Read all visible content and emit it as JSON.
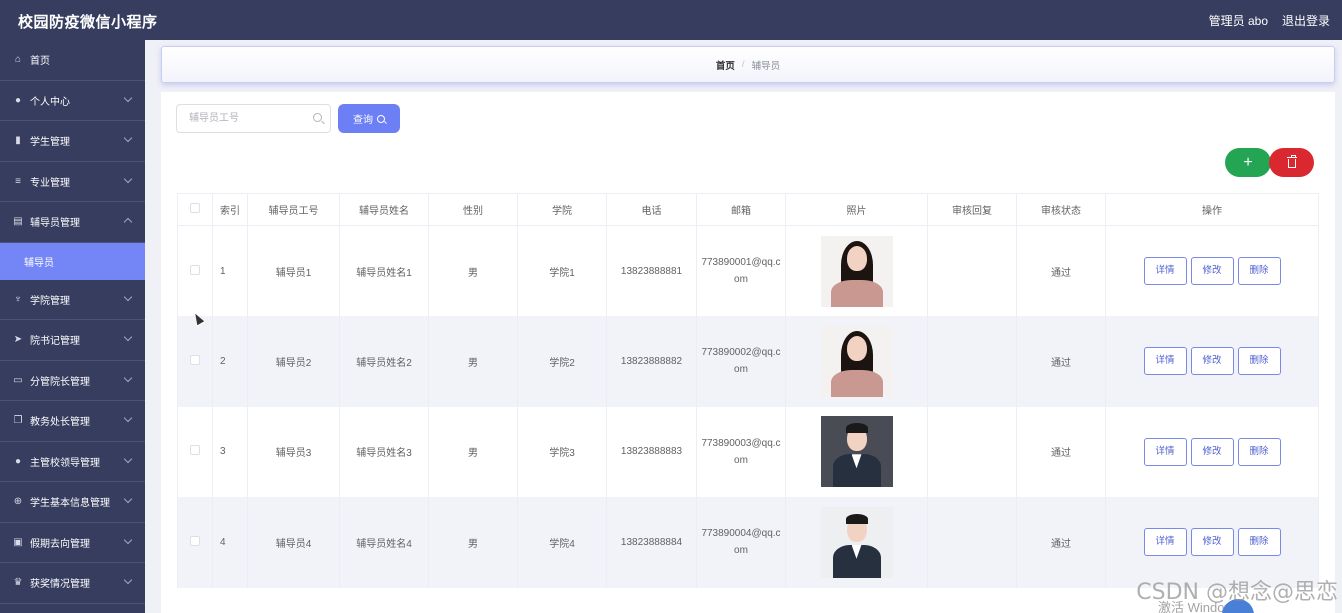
{
  "header": {
    "app_title": "校园防疫微信小程序",
    "user": "管理员 abo",
    "logout": "退出登录"
  },
  "sidebar": {
    "items": [
      {
        "label": "首页",
        "icon": "home-icon",
        "glyph": "⌂",
        "chevron": "none"
      },
      {
        "label": "个人中心",
        "icon": "user-icon",
        "glyph": "●",
        "chevron": "down"
      },
      {
        "label": "学生管理",
        "icon": "bar-chart-icon",
        "glyph": "▮",
        "chevron": "down"
      },
      {
        "label": "专业管理",
        "icon": "menu-icon",
        "glyph": "≡",
        "chevron": "down"
      },
      {
        "label": "辅导员管理",
        "icon": "edit-icon",
        "glyph": "▤",
        "chevron": "up",
        "expanded": true,
        "children": [
          "辅导员"
        ]
      },
      {
        "label": "学院管理",
        "icon": "microphone-icon",
        "glyph": "♆",
        "chevron": "down"
      },
      {
        "label": "院书记管理",
        "icon": "send-icon",
        "glyph": "➤",
        "chevron": "down"
      },
      {
        "label": "分管院长管理",
        "icon": "monitor-icon",
        "glyph": "▭",
        "chevron": "down"
      },
      {
        "label": "教务处长管理",
        "icon": "copy-icon",
        "glyph": "❐",
        "chevron": "down"
      },
      {
        "label": "主管校领导管理",
        "icon": "user-icon",
        "glyph": "●",
        "chevron": "down"
      },
      {
        "label": "学生基本信息管理",
        "icon": "globe-icon",
        "glyph": "⊕",
        "chevron": "down"
      },
      {
        "label": "假期去向管理",
        "icon": "clipboard-icon",
        "glyph": "▣",
        "chevron": "down"
      },
      {
        "label": "获奖情况管理",
        "icon": "trophy-icon",
        "glyph": "♛",
        "chevron": "down"
      }
    ]
  },
  "breadcrumb": {
    "home": "首页",
    "separator": "/",
    "current": "辅导员"
  },
  "search": {
    "placeholder": "辅导员工号",
    "value": "",
    "button_label": "查询"
  },
  "actions": {
    "add_label": "+",
    "delete_icon": "trash-icon"
  },
  "table": {
    "columns": [
      "索引",
      "辅导员工号",
      "辅导员姓名",
      "性别",
      "学院",
      "电话",
      "邮箱",
      "照片",
      "审核回复",
      "审核状态",
      "操作"
    ],
    "rows": [
      {
        "index": "1",
        "id": "辅导员1",
        "name": "辅导员姓名1",
        "gender": "男",
        "college": "学院1",
        "phone": "13823888881",
        "email": "773890001@qq.com",
        "photo": "female",
        "reply": "",
        "status": "通过"
      },
      {
        "index": "2",
        "id": "辅导员2",
        "name": "辅导员姓名2",
        "gender": "男",
        "college": "学院2",
        "phone": "13823888882",
        "email": "773890002@qq.com",
        "photo": "female",
        "reply": "",
        "status": "通过"
      },
      {
        "index": "3",
        "id": "辅导员3",
        "name": "辅导员姓名3",
        "gender": "男",
        "college": "学院3",
        "phone": "13823888883",
        "email": "773890003@qq.com",
        "photo": "male-dark",
        "reply": "",
        "status": "通过"
      },
      {
        "index": "4",
        "id": "辅导员4",
        "name": "辅导员姓名4",
        "gender": "男",
        "college": "学院4",
        "phone": "13823888884",
        "email": "773890004@qq.com",
        "photo": "male-light",
        "reply": "",
        "status": "通过"
      }
    ],
    "row_actions": {
      "detail": "详情",
      "edit": "修改",
      "delete": "删除"
    }
  },
  "overlay": {
    "watermark": "CSDN @想念@思恋",
    "activate": "激活 Windows"
  },
  "colors": {
    "topbar": "#363d5e",
    "sidebar": "#363d5e",
    "active_menu": "#7485f5",
    "primary": "#6d7ff5",
    "add": "#23a553",
    "delete": "#d9282f"
  }
}
